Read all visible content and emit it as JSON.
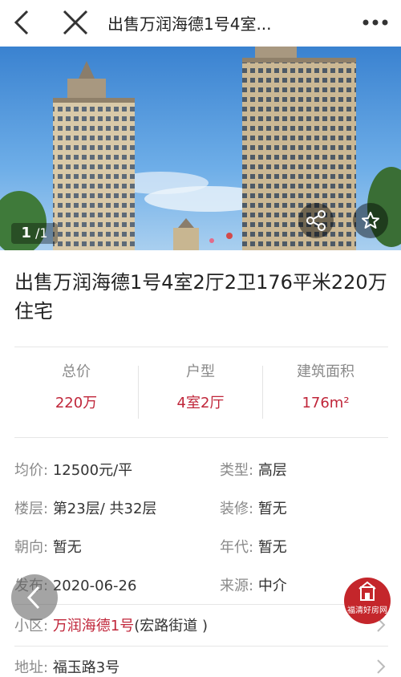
{
  "nav": {
    "title": "出售万润海德1号4室..."
  },
  "gallery": {
    "current": "1",
    "total": "/1"
  },
  "listing_title": "出售万润海德1号4室2厅2卫176平米220万住宅",
  "stats": [
    {
      "label": "总价",
      "value": "220万"
    },
    {
      "label": "户型",
      "value": "4室2厅"
    },
    {
      "label": "建筑面积",
      "value": "176m²"
    }
  ],
  "details": {
    "unit_price": {
      "key": "均价:",
      "value": "12500元/平"
    },
    "type": {
      "key": "类型:",
      "value": "高层"
    },
    "floor": {
      "key": "楼层:",
      "value": "第23层/ 共32层"
    },
    "decoration": {
      "key": "装修:",
      "value": "暂无"
    },
    "orientation": {
      "key": "朝向:",
      "value": "暂无"
    },
    "year": {
      "key": "年代:",
      "value": "暂无"
    },
    "published": {
      "key": "发布:",
      "value": "2020-06-26"
    },
    "source": {
      "key": "来源:",
      "value": "中介"
    }
  },
  "community": {
    "key": "小区:",
    "name": "万润海德1号",
    "area": "(宏路街道 )"
  },
  "address": {
    "key": "地址:",
    "value": "福玉路3号"
  },
  "brand": {
    "name": "福清好房网"
  },
  "colors": {
    "accent": "#c0263a",
    "badge": "#c4262b"
  },
  "icons": [
    "back-arrow-icon",
    "close-icon",
    "more-dots-icon",
    "share-icon",
    "star-icon",
    "chevron-right-icon",
    "house-logo-icon"
  ]
}
